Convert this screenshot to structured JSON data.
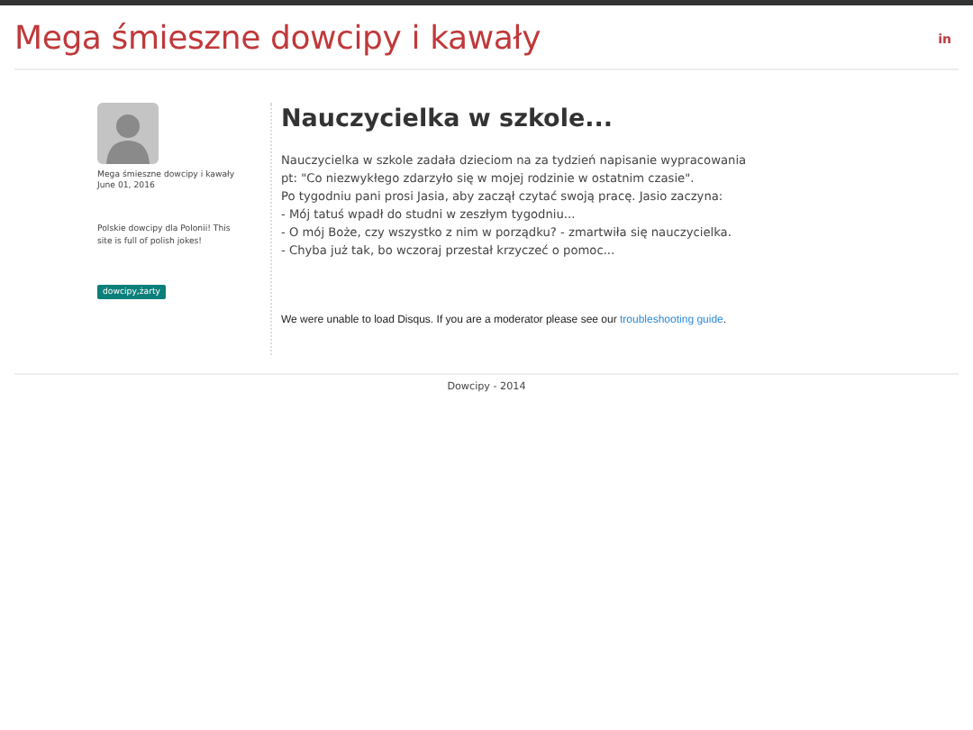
{
  "site_title": "Mega śmieszne dowcipy i kawały",
  "header_icon_text": "in",
  "author": {
    "name": "Mega śmieszne dowcipy i kawały",
    "date": "June 01, 2016",
    "description": "Polskie dowcipy dla Polonii! This site is full of polish jokes!",
    "tags": [
      "dowcipy,żarty"
    ]
  },
  "post": {
    "title": "Nauczycielka w szkole...",
    "lines": [
      "Nauczycielka w szkole zadała dzieciom na za tydzień napisanie wypracowania pt: \"Co niezwykłego zdarzyło się w mojej rodzinie w ostatnim czasie\".",
      "Po tygodniu pani prosi Jasia, aby zaczął czytać swoją pracę. Jasio zaczyna:",
      "- Mój tatuś wpadł do studni w zeszłym tygodniu...",
      "- O mój Boże, czy wszystko z nim w porządku? - zmartwiła się nauczycielka.",
      "- Chyba już tak, bo wczoraj przestał krzyczeć o pomoc..."
    ]
  },
  "disqus": {
    "text": "We were unable to load Disqus. If you are a moderator please see our ",
    "link": "troubleshooting guide",
    "tail": "."
  },
  "footer": "Dowcipy - 2014"
}
